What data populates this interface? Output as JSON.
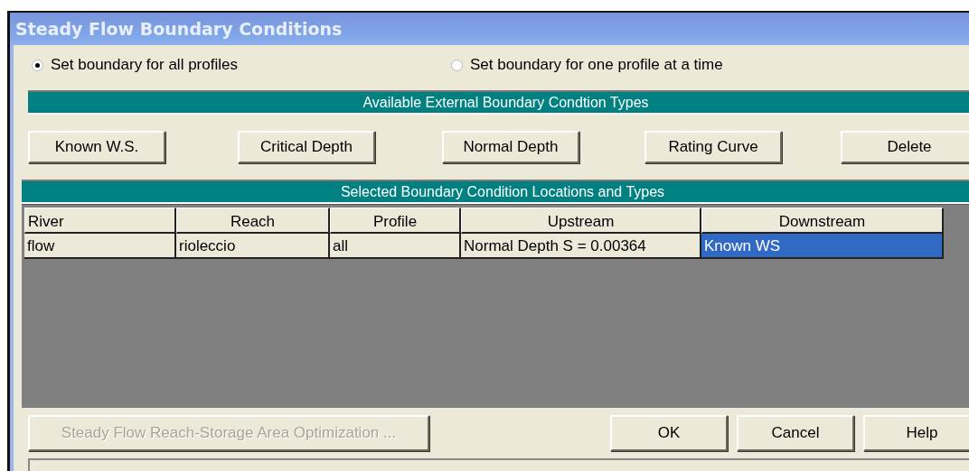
{
  "window": {
    "title": "Steady Flow Boundary Conditions"
  },
  "profile_mode": [
    {
      "label": "Set boundary for all profiles",
      "selected": true
    },
    {
      "label": "Set boundary for one profile at a time",
      "selected": false
    }
  ],
  "types_header": "Available External Boundary Condtion Types",
  "type_buttons": [
    "Known W.S.",
    "Critical Depth",
    "Normal Depth",
    "Rating Curve",
    "Delete"
  ],
  "locations_header": "Selected Boundary Condition Locations and Types",
  "table": {
    "columns": [
      "River",
      "Reach",
      "Profile",
      "Upstream",
      "Downstream"
    ],
    "rows": [
      {
        "cells": [
          {
            "text": "flow",
            "selected": false
          },
          {
            "text": "rioleccio",
            "selected": false
          },
          {
            "text": "all",
            "selected": false
          },
          {
            "text": "Normal Depth S = 0.00364",
            "selected": false
          },
          {
            "text": "Known WS",
            "selected": true
          }
        ]
      }
    ]
  },
  "bottom_buttons": [
    {
      "label": "Steady Flow Reach-Storage Area Optimization ...",
      "disabled": true
    },
    {
      "label": "OK",
      "disabled": false
    },
    {
      "label": "Cancel",
      "disabled": false
    },
    {
      "label": "Help",
      "disabled": false
    }
  ]
}
